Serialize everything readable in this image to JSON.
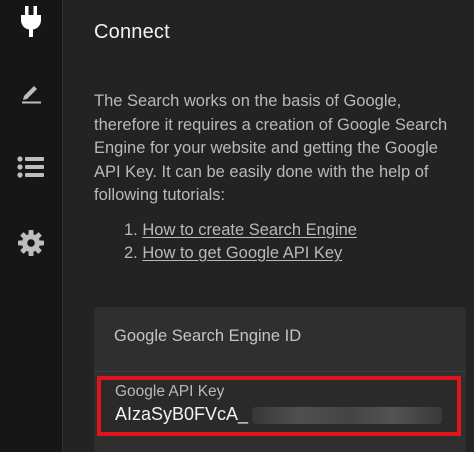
{
  "sidebar": {
    "items": [
      {
        "icon": "plug-icon",
        "active": true
      },
      {
        "icon": "pencil-icon",
        "active": false
      },
      {
        "icon": "list-icon",
        "active": false
      },
      {
        "icon": "gear-icon",
        "active": false
      }
    ]
  },
  "main": {
    "title": "Connect",
    "description": "The Search works on the basis of Google, therefore it requires a creation of Google Search Engine for your website and getting the Google API Key. It can be easily done with the help of following tutorials:",
    "tutorials": [
      {
        "number": "1.",
        "label": "How to create Search Engine"
      },
      {
        "number": "2.",
        "label": "How to get Google API Key"
      }
    ],
    "fields": {
      "search_engine_id_label": "Google Search Engine ID",
      "api_key_label": "Google API Key",
      "api_key_value": "AIzaSyB0FVcA_"
    }
  },
  "colors": {
    "highlight": "#e0141c",
    "sidebar_bg": "#161616",
    "main_bg": "#232323"
  }
}
